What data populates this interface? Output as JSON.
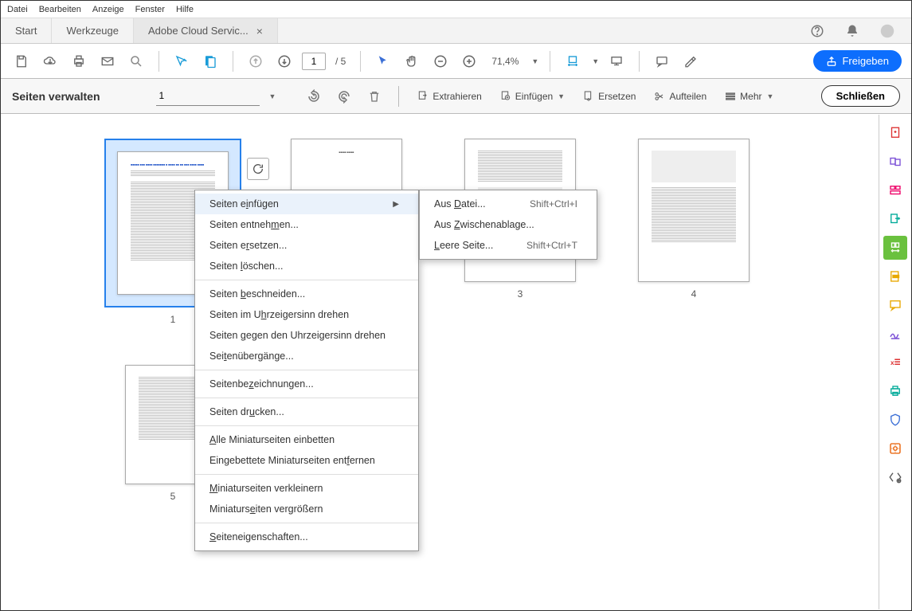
{
  "menubar": [
    "Datei",
    "Bearbeiten",
    "Anzeige",
    "Fenster",
    "Hilfe"
  ],
  "tabs": [
    {
      "label": "Start",
      "active": false,
      "closable": false
    },
    {
      "label": "Werkzeuge",
      "active": false,
      "closable": false
    },
    {
      "label": "Adobe Cloud Servic...",
      "active": true,
      "closable": true
    }
  ],
  "toolbar": {
    "current_page": "1",
    "total_pages": "/  5",
    "zoom": "71,4%",
    "share_label": "Freigeben"
  },
  "contextbar": {
    "title": "Seiten verwalten",
    "page_select": "1",
    "extract": "Extrahieren",
    "insert": "Einfügen",
    "replace": "Ersetzen",
    "split": "Aufteilen",
    "more": "Mehr",
    "close": "Schließen"
  },
  "thumbnails": [
    {
      "label": "1",
      "selected": true
    },
    {
      "label": "",
      "selected": false
    },
    {
      "label": "3",
      "selected": false
    },
    {
      "label": "4",
      "selected": false
    },
    {
      "label": "5",
      "selected": false
    }
  ],
  "context_menu_1": {
    "items": [
      {
        "label": "Seiten einfügen",
        "submenu": true,
        "highlight": true
      },
      {
        "label": "Seiten entnehmen..."
      },
      {
        "label": "Seiten ersetzen..."
      },
      {
        "label": "Seiten löschen..."
      },
      {
        "divider": true
      },
      {
        "label": "Seiten beschneiden..."
      },
      {
        "label": "Seiten im Uhrzeigersinn drehen"
      },
      {
        "label": "Seiten gegen den Uhrzeigersinn drehen"
      },
      {
        "label": "Seitenübergänge..."
      },
      {
        "divider": true
      },
      {
        "label": "Seitenbezeichnungen..."
      },
      {
        "divider": true
      },
      {
        "label": "Seiten drucken..."
      },
      {
        "divider": true
      },
      {
        "label": "Alle Miniaturseiten einbetten"
      },
      {
        "label": "Eingebettete Miniaturseiten entfernen"
      },
      {
        "divider": true
      },
      {
        "label": "Miniaturseiten verkleinern"
      },
      {
        "label": "Miniaturseiten vergrößern"
      },
      {
        "divider": true
      },
      {
        "label": "Seiteneigenschaften..."
      }
    ]
  },
  "context_menu_2": {
    "items": [
      {
        "label": "Aus Datei...",
        "shortcut": "Shift+Ctrl+I"
      },
      {
        "label": "Aus Zwischenablage..."
      },
      {
        "label": "Leere Seite...",
        "shortcut": "Shift+Ctrl+T"
      }
    ]
  },
  "side_tools": [
    "create-pdf",
    "combine",
    "edit",
    "export",
    "organize",
    "redact",
    "comment",
    "sign",
    "measure",
    "print",
    "protect",
    "optimize",
    "more-tools"
  ]
}
